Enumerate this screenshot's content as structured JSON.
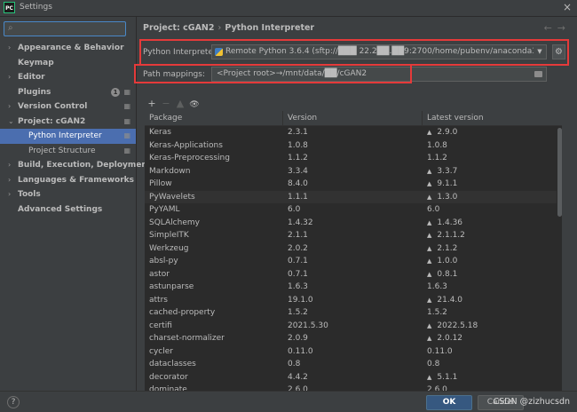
{
  "window": {
    "title": "Settings",
    "logo_text": "PC"
  },
  "sidebar": {
    "search_placeholder": "",
    "items": [
      {
        "label": "Appearance & Behavior",
        "arrow": "›"
      },
      {
        "label": "Keymap",
        "arrow": ""
      },
      {
        "label": "Editor",
        "arrow": "›"
      },
      {
        "label": "Plugins",
        "arrow": "",
        "badge": "1"
      },
      {
        "label": "Version Control",
        "arrow": "›"
      },
      {
        "label": "Project: cGAN2",
        "arrow": "⌄"
      },
      {
        "label": "Python Interpreter",
        "sub": true,
        "selected": true
      },
      {
        "label": "Project Structure",
        "sub": true
      },
      {
        "label": "Build, Execution, Deployment",
        "arrow": "›"
      },
      {
        "label": "Languages & Frameworks",
        "arrow": "›"
      },
      {
        "label": "Tools",
        "arrow": "›"
      },
      {
        "label": "Advanced Settings",
        "arrow": ""
      }
    ]
  },
  "breadcrumb": {
    "project": "Project: cGAN2",
    "separator": "›",
    "page": "Python Interpreter"
  },
  "interpreter": {
    "label": "Python Interpreter:",
    "value": "Remote Python 3.6.4 (sftp://███ 22.2██.██9:2700/home/pubenv/anaconda3/envs/tf115/b"
  },
  "path_mappings": {
    "label": "Path mappings:",
    "value": "<Project root>→/mnt/data/██/cGAN2"
  },
  "toolbar": {
    "add": "+",
    "remove": "−",
    "up": "▲",
    "show": "👁"
  },
  "table": {
    "headers": [
      "Package",
      "Version",
      "Latest version"
    ],
    "rows": [
      {
        "package": "Keras",
        "version": "2.3.1",
        "latest": "2.9.0",
        "upgrade": true
      },
      {
        "package": "Keras-Applications",
        "version": "1.0.8",
        "latest": "1.0.8",
        "upgrade": false
      },
      {
        "package": "Keras-Preprocessing",
        "version": "1.1.2",
        "latest": "1.1.2",
        "upgrade": false
      },
      {
        "package": "Markdown",
        "version": "3.3.4",
        "latest": "3.3.7",
        "upgrade": true
      },
      {
        "package": "Pillow",
        "version": "8.4.0",
        "latest": "9.1.1",
        "upgrade": true
      },
      {
        "package": "PyWavelets",
        "version": "1.1.1",
        "latest": "1.3.0",
        "upgrade": true,
        "highlighted": true
      },
      {
        "package": "PyYAML",
        "version": "6.0",
        "latest": "6.0",
        "upgrade": false
      },
      {
        "package": "SQLAlchemy",
        "version": "1.4.32",
        "latest": "1.4.36",
        "upgrade": true
      },
      {
        "package": "SimpleITK",
        "version": "2.1.1",
        "latest": "2.1.1.2",
        "upgrade": true
      },
      {
        "package": "Werkzeug",
        "version": "2.0.2",
        "latest": "2.1.2",
        "upgrade": true
      },
      {
        "package": "absl-py",
        "version": "0.7.1",
        "latest": "1.0.0",
        "upgrade": true
      },
      {
        "package": "astor",
        "version": "0.7.1",
        "latest": "0.8.1",
        "upgrade": true
      },
      {
        "package": "astunparse",
        "version": "1.6.3",
        "latest": "1.6.3",
        "upgrade": false
      },
      {
        "package": "attrs",
        "version": "19.1.0",
        "latest": "21.4.0",
        "upgrade": true
      },
      {
        "package": "cached-property",
        "version": "1.5.2",
        "latest": "1.5.2",
        "upgrade": false
      },
      {
        "package": "certifi",
        "version": "2021.5.30",
        "latest": "2022.5.18",
        "upgrade": true
      },
      {
        "package": "charset-normalizer",
        "version": "2.0.9",
        "latest": "2.0.12",
        "upgrade": true
      },
      {
        "package": "cycler",
        "version": "0.11.0",
        "latest": "0.11.0",
        "upgrade": false
      },
      {
        "package": "dataclasses",
        "version": "0.8",
        "latest": "0.8",
        "upgrade": false
      },
      {
        "package": "decorator",
        "version": "4.4.2",
        "latest": "5.1.1",
        "upgrade": true
      },
      {
        "package": "dominate",
        "version": "2.6.0",
        "latest": "2.6.0",
        "upgrade": false
      }
    ]
  },
  "buttons": {
    "help": "?",
    "ok": "OK",
    "cancel": "Cancel"
  },
  "watermark": "CSDN @zizhucsdn",
  "colors": {
    "selected": "#4b6eaf",
    "ok_button": "#365880",
    "highlight_box": "#e53a3a",
    "background": "#3c3f41",
    "table_bg": "#2b2b2b"
  }
}
